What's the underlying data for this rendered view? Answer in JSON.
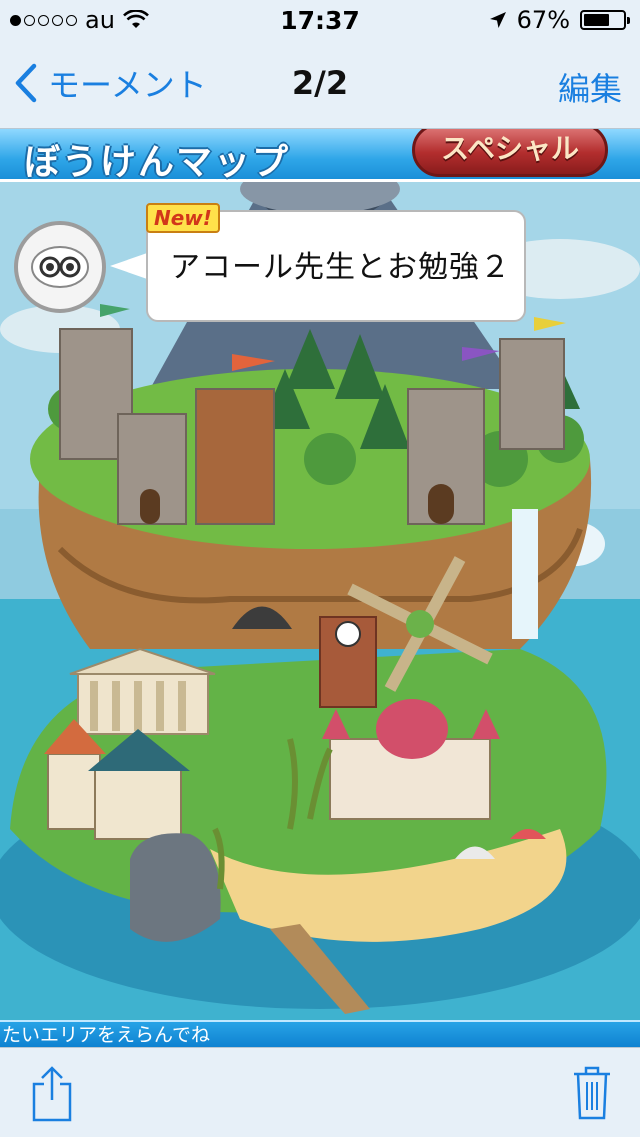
{
  "status_bar": {
    "carrier": "au",
    "time": "17:37",
    "battery_percent_text": "67%",
    "battery_level": 0.67,
    "signal_bars": 1,
    "icons": [
      "wifi-icon",
      "location-arrow-icon",
      "battery-icon"
    ]
  },
  "nav": {
    "back_label": "モーメント",
    "title": "2/2",
    "edit_label": "編集"
  },
  "game": {
    "banner_title": "ぼうけんマップ",
    "special_label": "スペシャル",
    "new_badge": "New!",
    "bubble_text": "アコール先生とお勉強２",
    "footer_text": "たいエリアをえらんでね"
  },
  "toolbar": {
    "share_icon": "share-icon",
    "trash_icon": "trash-icon"
  },
  "colors": {
    "ios_blue": "#1a7fe0",
    "banner_blue": "#2fa6e8",
    "special_red": "#b32e2e",
    "sea": "#3aa8c7"
  }
}
